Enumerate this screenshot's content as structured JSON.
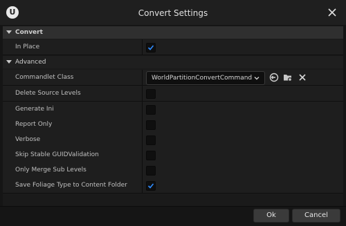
{
  "window": {
    "title": "Convert Settings",
    "logo_text": "U",
    "icons": {
      "close": "close-icon",
      "logo": "unreal-logo-icon"
    }
  },
  "sections": {
    "convert": {
      "label": "Convert"
    },
    "advanced": {
      "label": "Advanced"
    }
  },
  "properties": {
    "in_place": {
      "label": "In Place",
      "checked": true
    },
    "commandlet_class": {
      "label": "Commandlet Class",
      "value": "WorldPartitionConvertCommandlet"
    },
    "delete_source_levels": {
      "label": "Delete Source Levels",
      "checked": false
    },
    "generate_ini": {
      "label": "Generate Ini",
      "checked": false
    },
    "report_only": {
      "label": "Report Only",
      "checked": false
    },
    "verbose": {
      "label": "Verbose",
      "checked": false
    },
    "skip_stable_guid": {
      "label": "Skip Stable GUIDValidation",
      "checked": false
    },
    "only_merge_sub_levels": {
      "label": "Only Merge Sub Levels",
      "checked": false
    },
    "save_foliage_type": {
      "label": "Save Foliage Type to Content Folder",
      "checked": true
    }
  },
  "commandlet_icons": [
    "use-selected-icon",
    "browse-icon",
    "clear-icon"
  ],
  "buttons": {
    "ok": "Ok",
    "cancel": "Cancel"
  },
  "colors": {
    "accent": "#1e90ff",
    "check": "#2f8cff",
    "bg": "#151515"
  }
}
